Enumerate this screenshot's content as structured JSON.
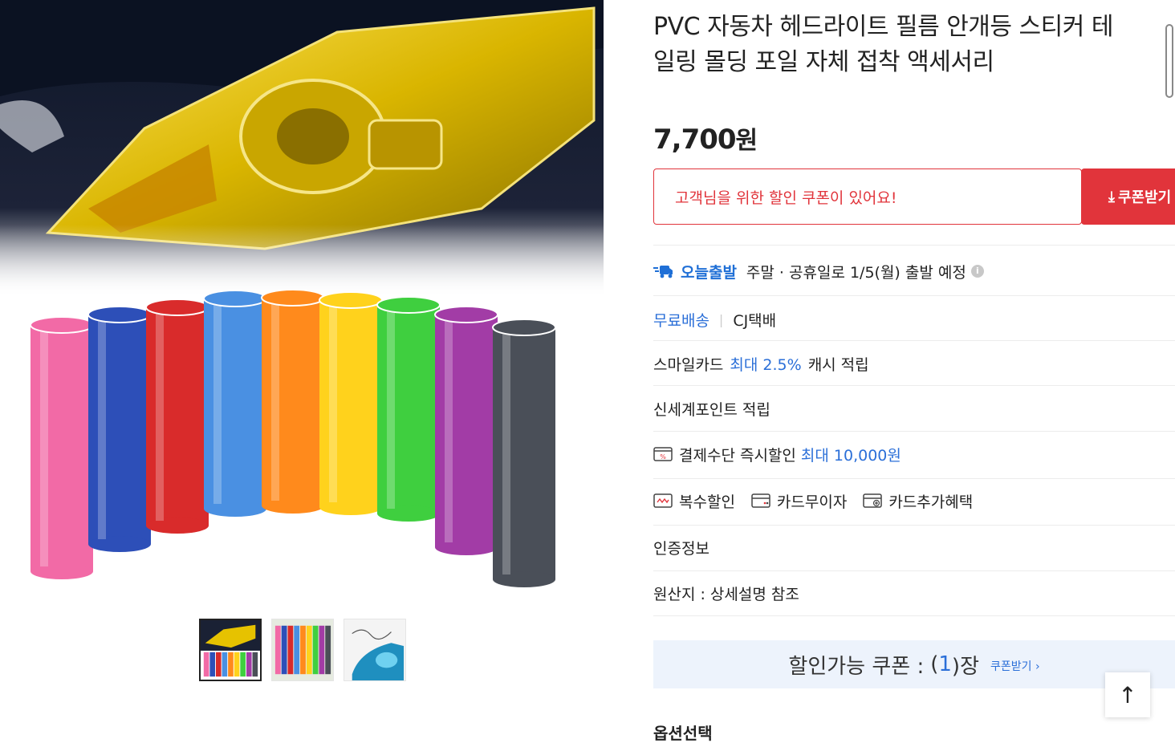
{
  "product": {
    "title": "PVC 자동차 헤드라이트 필름 안개등 스티커 테일링 몰딩 포일 자체 접착 액세서리",
    "price": "7,700",
    "price_unit": "원"
  },
  "coupon": {
    "message": "고객님을 위한 할인 쿠폰이 있어요!",
    "button_label": "쿠폰받기"
  },
  "shipping": {
    "today_label": "오늘출발",
    "today_desc": "주말 · 공휴일로 1/5(월) 출발 예정",
    "free_label": "무료배송",
    "carrier": "CJ택배"
  },
  "smile_card": {
    "prefix": "스마일카드",
    "highlight": "최대 2.5%",
    "suffix": "캐시 적립"
  },
  "shinsegae_point": "신세계포인트 적립",
  "payment_discount": {
    "prefix": "결제수단 즉시할인",
    "highlight": "최대 10,000원"
  },
  "benefits": [
    "복수할인",
    "카드무이자",
    "카드추가혜택"
  ],
  "certification": "인증정보",
  "origin": "원산지 : 상세설명 참조",
  "available_coupon": {
    "label": "할인가능 쿠폰 :",
    "open": "(",
    "count": "1",
    "close": ")장",
    "get_link": "쿠폰받기 ›"
  },
  "options_label": "옵션선택",
  "film_colors": [
    "#f26aa6",
    "#2d4fb8",
    "#d92b2b",
    "#4a90e2",
    "#ff8a1c",
    "#ffd21c",
    "#3fcf3f",
    "#a23ca6",
    "#4a4f58"
  ],
  "colors": {
    "accent_red": "#e1343b",
    "accent_blue": "#2b6fd8",
    "coupon_bg": "#edf3fc"
  }
}
